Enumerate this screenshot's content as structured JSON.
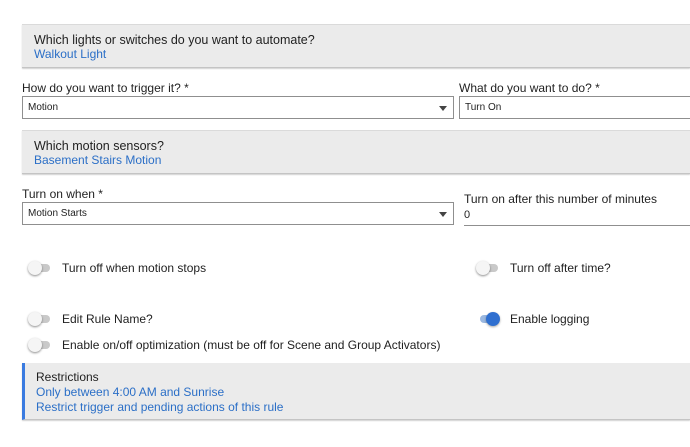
{
  "lights_card": {
    "title": "Which lights or switches do you want to automate?",
    "value": "Walkout Light"
  },
  "trigger": {
    "label": "How do you want to trigger it? *",
    "value": "Motion"
  },
  "action": {
    "label": "What do you want to do? *",
    "value": "Turn On"
  },
  "motion_card": {
    "title": "Which motion sensors?",
    "value": "Basement Stairs Motion"
  },
  "turn_on_when": {
    "label": "Turn on when *",
    "value": "Motion Starts"
  },
  "minutes": {
    "label": "Turn on after this number of minutes",
    "value": "0"
  },
  "toggles": {
    "off_when_stops": {
      "label": "Turn off when motion stops",
      "on": false
    },
    "off_after_time": {
      "label": "Turn off after time?",
      "on": false
    },
    "edit_rule_name": {
      "label": "Edit Rule Name?",
      "on": false
    },
    "enable_logging": {
      "label": "Enable logging",
      "on": true
    },
    "optimization": {
      "label": "Enable on/off optimization (must be off for Scene and Group Activators)",
      "on": false
    }
  },
  "restrictions": {
    "title": "Restrictions",
    "line1": "Only between 4:00 AM and Sunrise",
    "line2": "Restrict trigger and pending actions of this rule"
  },
  "colors": {
    "link": "#2b6fc7",
    "accent": "#2f6fd0",
    "card_bg": "#ebebeb"
  }
}
